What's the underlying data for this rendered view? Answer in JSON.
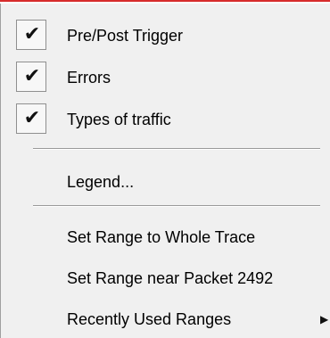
{
  "menu": {
    "items": [
      {
        "label": "Pre/Post Trigger",
        "checked": true,
        "check_icon": "checkmark-icon"
      },
      {
        "label": "Errors",
        "checked": true,
        "check_icon": "checkmark-icon"
      },
      {
        "label": "Types of traffic",
        "checked": true,
        "check_icon": "checkmark-icon"
      },
      {
        "label": "Legend...",
        "checked": false
      },
      {
        "label": "Set Range to Whole Trace",
        "checked": false
      },
      {
        "label": "Set Range near Packet 2492",
        "checked": false
      },
      {
        "label": "Recently Used Ranges",
        "checked": false,
        "submenu": true,
        "submenu_icon": "submenu-arrow-icon"
      }
    ],
    "glyphs": {
      "check": "✔",
      "submenu_arrow": "▶"
    },
    "colors": {
      "menu_background": "#f0f0f0",
      "top_accent": "#d72b2b",
      "text": "#000000"
    }
  }
}
